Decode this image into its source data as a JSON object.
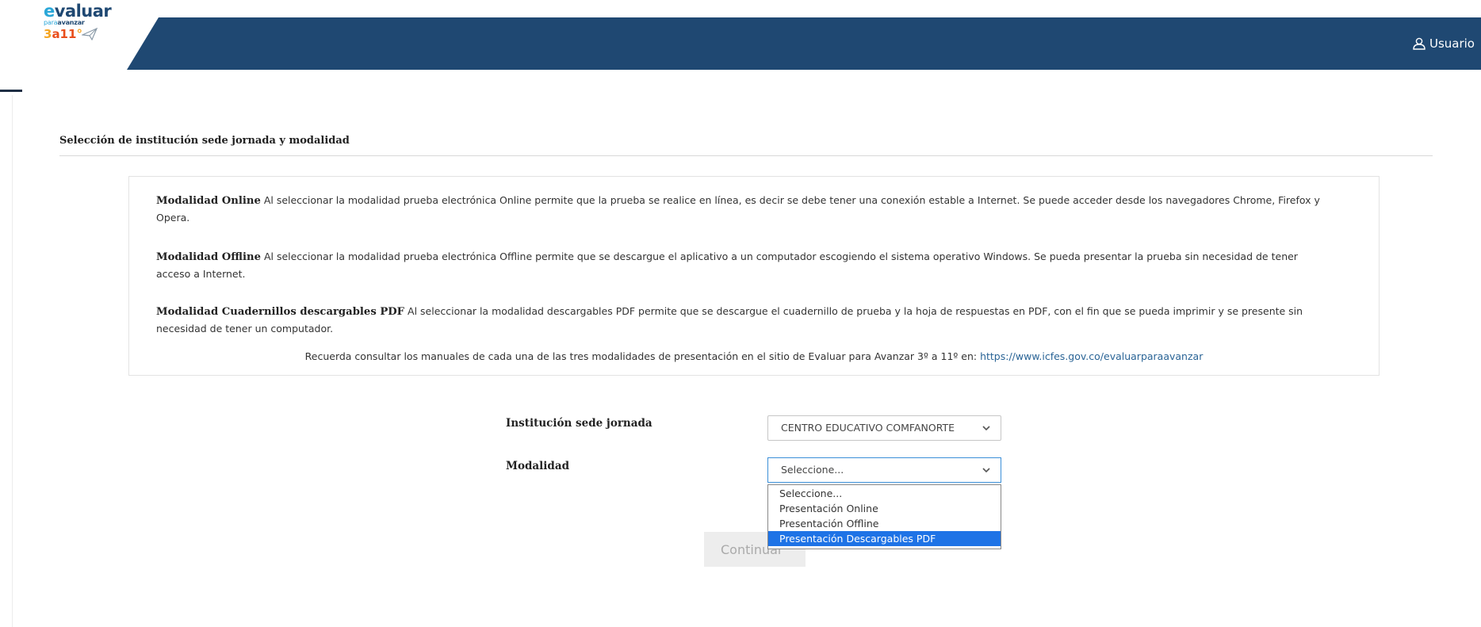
{
  "header": {
    "logo": {
      "word": "evaluar",
      "sub_left": "para",
      "sub_right": "avanzar",
      "grade": "3°a11°"
    },
    "user_label": "Usuario",
    "colors": {
      "navy": "#1f4872",
      "accent": "#2aa7d8"
    }
  },
  "section": {
    "title": "Selección de institución sede jornada y modalidad"
  },
  "info": {
    "online": {
      "title": "Modalidad Online",
      "text": " Al seleccionar la modalidad prueba electrónica Online permite que la prueba se realice en línea, es decir se debe tener una conexión estable a Internet. Se puede acceder desde los navegadores Chrome, Firefox y Opera."
    },
    "offline": {
      "title": "Modalidad Offline",
      "text": " Al seleccionar la modalidad prueba electrónica Offline permite que se descargue el aplicativo a un computador escogiendo el sistema operativo Windows. Se pueda presentar la prueba sin necesidad de tener acceso a Internet."
    },
    "pdf": {
      "title": "Modalidad Cuadernillos descargables PDF",
      "text": " Al seleccionar la modalidad descargables PDF permite que se descargue el cuadernillo de prueba y la hoja de respuestas en PDF, con el fin que se pueda imprimir y se presente sin necesidad de tener un computador."
    },
    "note_text": "Recuerda consultar los manuales de cada una de las tres modalidades de presentación en el sitio de Evaluar para Avanzar 3º a 11º en: ",
    "note_link": "https://www.icfes.gov.co/evaluarparaavanzar"
  },
  "form": {
    "institucion_label": "Institución sede jornada",
    "institucion_value": "CENTRO EDUCATIVO COMFANORTE",
    "modalidad_label": "Modalidad",
    "modalidad_value": "Seleccione...",
    "modalidad_options": [
      "Seleccione...",
      "Presentación Online",
      "Presentación Offline",
      "Presentación Descargables PDF"
    ],
    "highlighted_option": "Presentación Descargables PDF",
    "continue_label": "Continuar"
  }
}
